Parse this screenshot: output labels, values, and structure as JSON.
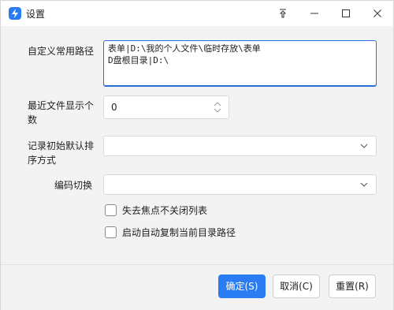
{
  "window": {
    "title": "设置",
    "controls": {
      "pin_icon": "pin-icon",
      "minimize_icon": "minimize-icon",
      "maximize_icon": "maximize-icon",
      "close_icon": "close-icon"
    }
  },
  "form": {
    "paths": {
      "label": "自定义常用路径",
      "lines": [
        "表单|D:\\我的个人文件\\临时存放\\表单",
        "D盘根目录|D:\\"
      ]
    },
    "recent_count": {
      "label_line1": "最近文件显示个",
      "label_line2": "数",
      "value": "0"
    },
    "record_sort": {
      "label_line1": "记录初始默认排",
      "label_line2": "序方式",
      "value": ""
    },
    "encoding": {
      "label": "编码切换",
      "value": ""
    },
    "checkboxes": [
      {
        "label": "失去焦点不关闭列表",
        "checked": false
      },
      {
        "label": "启动自动复制当前目录路径",
        "checked": false
      }
    ]
  },
  "buttons": {
    "ok": "确定(S)",
    "cancel": "取消(C)",
    "reset": "重置(R)"
  },
  "colors": {
    "accent": "#2a7cf3",
    "background": "#f3f3f3"
  }
}
